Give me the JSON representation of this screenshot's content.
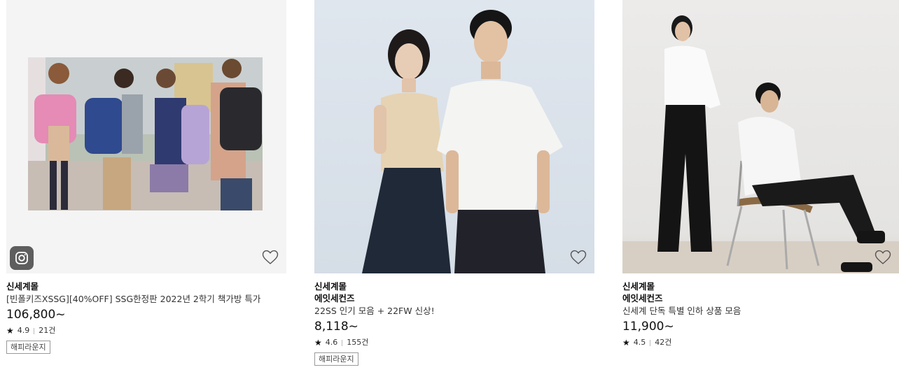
{
  "products": [
    {
      "mall": "신세계몰",
      "brand": "",
      "title": "[빈폴키즈XSSG][40%OFF] SSG한정판 2022년 2학기 책가방 특가",
      "price": "106,800~",
      "rating": "4.9",
      "reviews": "21건",
      "badge": "해피라운지",
      "image": "kids-backpacks-photo",
      "has_instagram": true
    },
    {
      "mall": "신세계몰",
      "brand": "에잇세컨즈",
      "title": "22SS 인기 모음 + 22FW 신상!",
      "price": "8,118~",
      "rating": "4.6",
      "reviews": "155건",
      "badge": "해피라운지",
      "image": "couple-fashion-photo",
      "has_instagram": false
    },
    {
      "mall": "신세계몰",
      "brand": "에잇세컨즈",
      "title": "신세계 단독 특별 인하 상품 모음",
      "price": "11,900~",
      "rating": "4.5",
      "reviews": "42건",
      "badge": "",
      "image": "white-shirt-models-photo",
      "has_instagram": false
    }
  ],
  "icons": {
    "wishlist": "heart-outline-icon",
    "instagram": "instagram-icon",
    "rating": "star-icon"
  }
}
